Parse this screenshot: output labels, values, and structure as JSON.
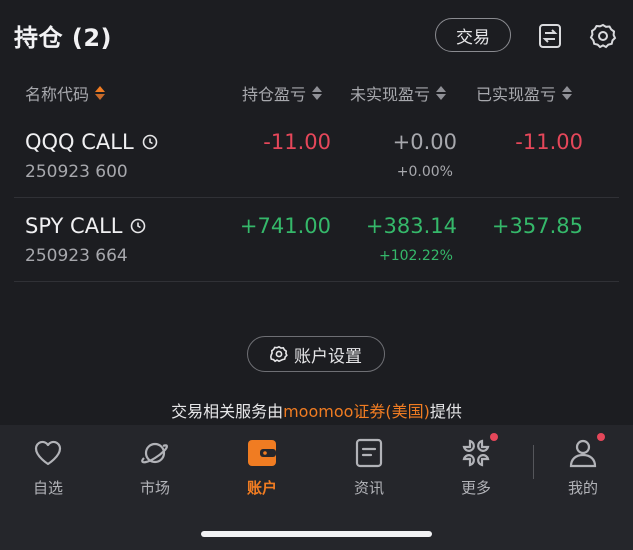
{
  "header": {
    "title": "持仓 (2)",
    "trade_label": "交易"
  },
  "columns": {
    "name": "名称代码",
    "position_pl": "持仓盈亏",
    "unrealized_pl": "未实现盈亏",
    "realized_pl": "已实现盈亏"
  },
  "positions": [
    {
      "symbol": "QQQ CALL",
      "code": "250923 600",
      "position_pl": "-11.00",
      "unrealized_pl": "+0.00",
      "unrealized_pct": "+0.00%",
      "realized_pl": "-11.00"
    },
    {
      "symbol": "SPY CALL",
      "code": "250923 664",
      "position_pl": "+741.00",
      "unrealized_pl": "+383.14",
      "unrealized_pct": "+102.22%",
      "realized_pl": "+357.85"
    }
  ],
  "account_settings_label": "账户设置",
  "provider": {
    "prefix": "交易相关服务由",
    "brand": "moomoo证券(美国)",
    "suffix": "提供"
  },
  "tabs": [
    {
      "label": "自选",
      "icon": "heart-icon"
    },
    {
      "label": "市场",
      "icon": "planet-icon"
    },
    {
      "label": "账户",
      "icon": "wallet-icon",
      "active": true
    },
    {
      "label": "资讯",
      "icon": "news-icon"
    },
    {
      "label": "更多",
      "icon": "grid-icon",
      "badge": true
    },
    {
      "label": "我的",
      "icon": "user-icon",
      "badge": true
    }
  ],
  "colors": {
    "accent": "#f07c22",
    "loss": "#e5475a",
    "gain": "#35b86a",
    "neutral": "#a7a8ad",
    "background": "#1c1d21"
  }
}
